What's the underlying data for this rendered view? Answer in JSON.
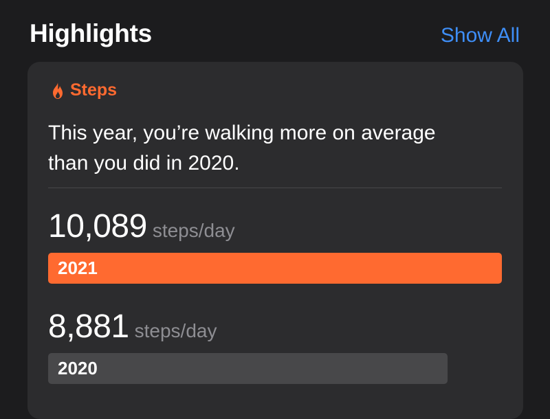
{
  "header": {
    "title": "Highlights",
    "show_all": "Show All"
  },
  "highlight": {
    "category": "Steps",
    "category_icon": "flame-icon",
    "accent_color": "#ff6a30",
    "summary_line1": "This year, you’re walking more on average",
    "summary_line2": "than you did in 2020.",
    "comparison": [
      {
        "value": "10,089",
        "unit": "steps/day",
        "year": "2021",
        "fraction": 1.0,
        "color": "#ff6a30"
      },
      {
        "value": "8,881",
        "unit": "steps/day",
        "year": "2020",
        "fraction": 0.8803,
        "color": "#48484a"
      }
    ]
  }
}
